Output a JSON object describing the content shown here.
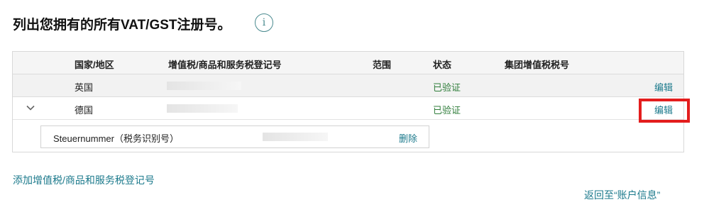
{
  "page": {
    "title": "列出您拥有的所有VAT/GST注册号。",
    "info_icon": "i"
  },
  "table": {
    "headers": {
      "country": "国家/地区",
      "vat_number": "增值税/商品和服务税登记号",
      "scope": "范围",
      "status": "状态",
      "group_vat": "集团增值税税号"
    },
    "rows": [
      {
        "country": "英国",
        "status": "已验证",
        "action": "编辑",
        "vat_number_redacted": true
      },
      {
        "country": "德国",
        "status": "已验证",
        "action": "编辑",
        "vat_number_redacted": true,
        "expanded": true
      }
    ],
    "sub_row": {
      "label": "Steuernummer（税务识别号）",
      "value_redacted": true,
      "action": "删除"
    }
  },
  "links": {
    "add": "添加增值税/商品和服务税登记号",
    "back": "返回至“账户信息”"
  },
  "icons": {
    "info": "info-icon",
    "expand": "chevron-down-icon"
  },
  "colors": {
    "link": "#1c7a8c",
    "verified": "#2f7d3a",
    "highlight": "#e31d1d"
  }
}
